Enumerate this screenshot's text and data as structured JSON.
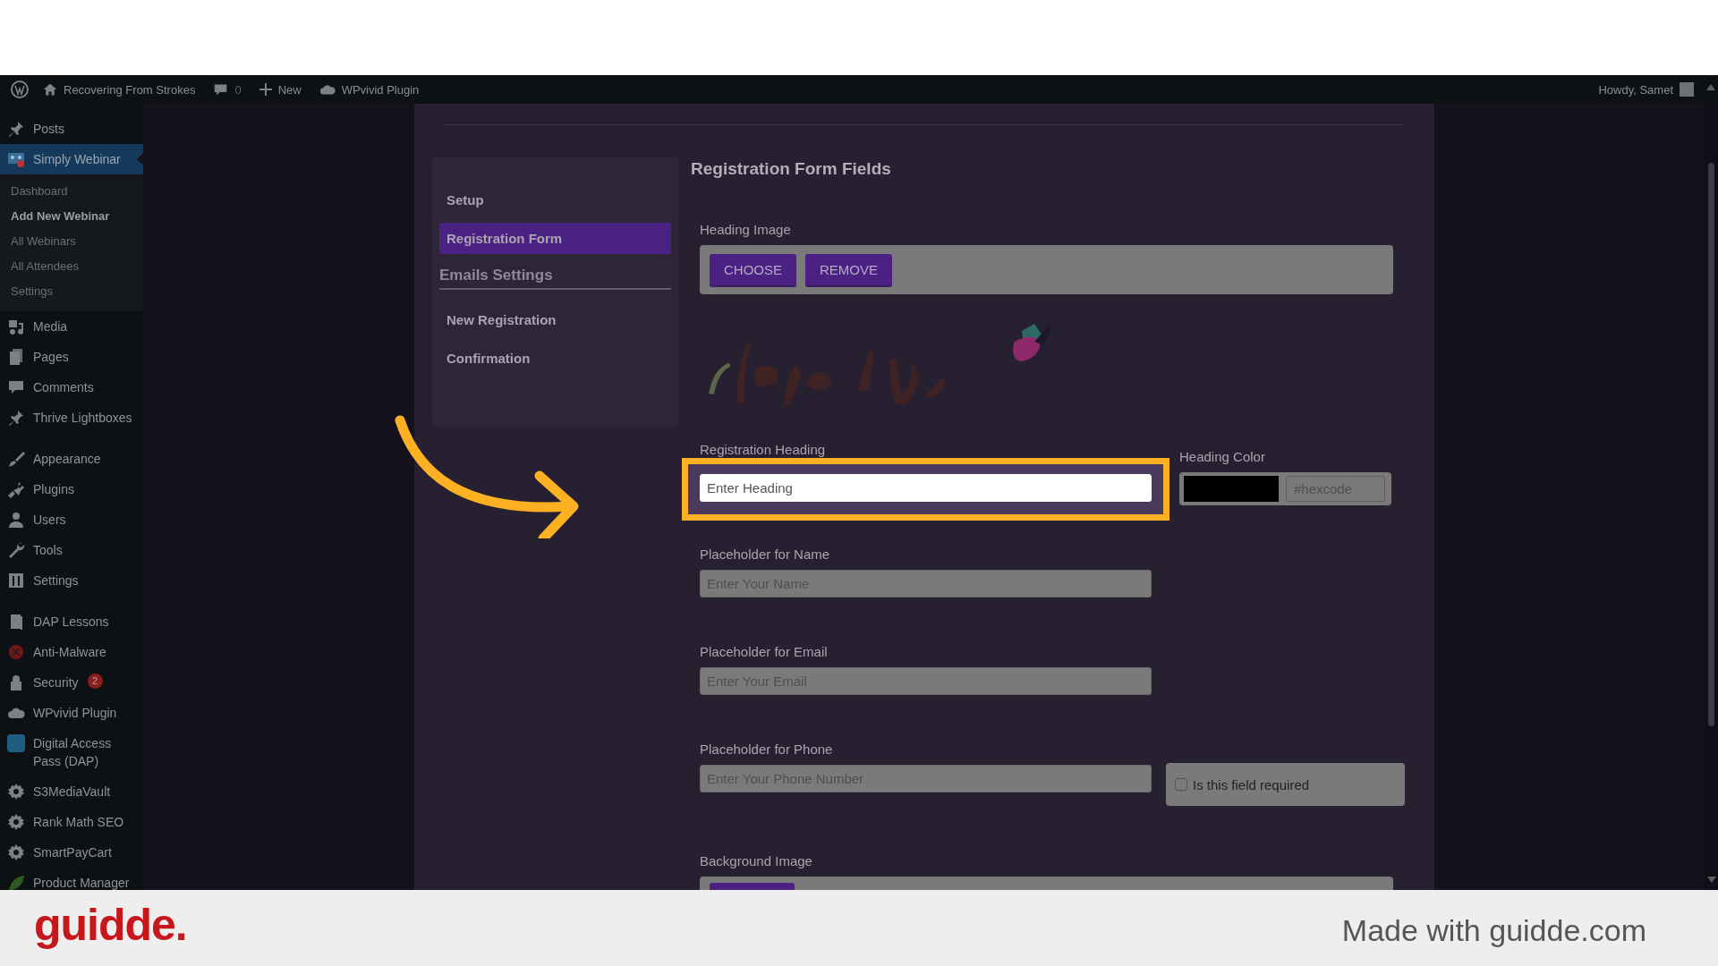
{
  "admin_bar": {
    "site_name": "Recovering From Strokes",
    "comments_count": "0",
    "new_label": "New",
    "plugin_label": "WPvivid Plugin",
    "greeting": "Howdy, Samet"
  },
  "sidebar": {
    "groups": [
      [
        {
          "label": "Posts",
          "selected": false
        },
        {
          "label": "Simply Webinar",
          "selected": true,
          "children": [
            {
              "label": "Dashboard",
              "selected": false
            },
            {
              "label": "Add New Webinar",
              "selected": true
            },
            {
              "label": "All Webinars",
              "selected": false
            },
            {
              "label": "All Attendees",
              "selected": false
            },
            {
              "label": "Settings",
              "selected": false
            }
          ]
        },
        {
          "label": "Media",
          "selected": false
        },
        {
          "label": "Pages",
          "selected": false
        },
        {
          "label": "Comments",
          "selected": false
        },
        {
          "label": "Thrive Lightboxes",
          "selected": false
        }
      ],
      [
        {
          "label": "Appearance",
          "selected": false
        },
        {
          "label": "Plugins",
          "selected": false
        },
        {
          "label": "Users",
          "selected": false
        },
        {
          "label": "Tools",
          "selected": false
        },
        {
          "label": "Settings",
          "selected": false
        }
      ],
      [
        {
          "label": "DAP Lessons",
          "selected": false
        },
        {
          "label": "Anti-Malware",
          "selected": false
        },
        {
          "label": "Security",
          "selected": false,
          "badge": "2"
        },
        {
          "label": "WPvivid Plugin",
          "selected": false
        },
        {
          "label": "Digital Access Pass (DAP)",
          "selected": false
        },
        {
          "label": "S3MediaVault",
          "selected": false
        },
        {
          "label": "Rank Math SEO",
          "selected": false
        },
        {
          "label": "SmartPayCart",
          "selected": false
        },
        {
          "label": "Product Manager",
          "selected": false
        }
      ]
    ]
  },
  "editor": {
    "nav": [
      {
        "kind": "item",
        "label": "Setup",
        "selected": false
      },
      {
        "kind": "item",
        "label": "Registration Form",
        "selected": true
      },
      {
        "kind": "heading",
        "label": "Emails Settings"
      },
      {
        "kind": "item",
        "label": "New Registration",
        "selected": false
      },
      {
        "kind": "item",
        "label": "Confirmation",
        "selected": false
      }
    ],
    "title": "Registration Form Fields",
    "heading_image": {
      "label": "Heading Image",
      "buttons": [
        "CHOOSE",
        "REMOVE"
      ],
      "preview": {
        "kind": "picture"
      }
    },
    "registration_heading": {
      "label": "Registration Heading",
      "placeholder": "Enter Heading",
      "focused": true
    },
    "heading_color": {
      "label": "Heading Color",
      "placeholder": "#hexcode"
    },
    "fields": [
      {
        "label": "Placeholder for Name",
        "placeholder": "Enter Your Name"
      },
      {
        "label": "Placeholder for Email",
        "placeholder": "Enter Your Email"
      },
      {
        "label": "Placeholder for Phone",
        "placeholder": "Enter Your Phone Number",
        "required_option": {
          "label": "Is this field required",
          "checked": false
        }
      }
    ],
    "background_image": {
      "label": "Background Image"
    }
  },
  "footer": {
    "logo": "guidde.",
    "credit": "Made with guidde.com"
  }
}
